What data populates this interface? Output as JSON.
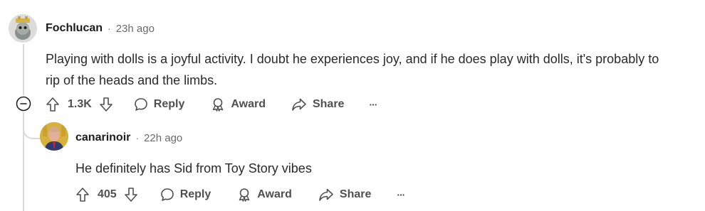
{
  "comment1": {
    "author": "Fochlucan",
    "separator": "·",
    "time": "23h ago",
    "body_line1": "Playing with dolls is a joyful activity. I doubt he experiences joy, and if he does play with dolls, it's probably to",
    "body_line2": "rip of the heads and the limbs.",
    "votes": "1.3K",
    "reply_label": "Reply",
    "award_label": "Award",
    "share_label": "Share",
    "more_label": "···"
  },
  "comment2": {
    "author": "canarinoir",
    "separator": "·",
    "time": "22h ago",
    "body": "He definitely has Sid from Toy Story vibes",
    "votes": "405",
    "reply_label": "Reply",
    "award_label": "Award",
    "share_label": "Share",
    "more_label": "···"
  },
  "colors": {
    "text": "#1c1c1c",
    "meta": "#6b6b6b",
    "action": "#505050",
    "thread_line": "#dadada"
  }
}
